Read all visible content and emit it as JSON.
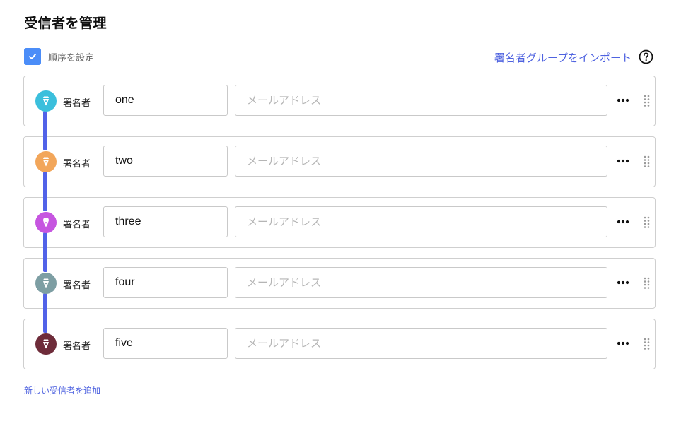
{
  "header": {
    "title": "受信者を管理"
  },
  "order": {
    "label": "順序を設定",
    "checked": true
  },
  "import_link": "署名者グループをインポート",
  "colors": {
    "accent": "#4f63e0",
    "connector": "#5162e8",
    "checkbox": "#4b8df8"
  },
  "recipients": [
    {
      "role": "署名者",
      "name": "one",
      "email": "",
      "email_placeholder": "メールアドレス",
      "avatar_color": "#3bbfdc",
      "icon": "pen-nib-icon"
    },
    {
      "role": "署名者",
      "name": "two",
      "email": "",
      "email_placeholder": "メールアドレス",
      "avatar_color": "#f2a65a",
      "icon": "pen-nib-icon"
    },
    {
      "role": "署名者",
      "name": "three",
      "email": "",
      "email_placeholder": "メールアドレス",
      "avatar_color": "#c655e0",
      "icon": "pen-nib-icon"
    },
    {
      "role": "署名者",
      "name": "four",
      "email": "",
      "email_placeholder": "メールアドレス",
      "avatar_color": "#7d9ea3",
      "icon": "pen-nib-icon"
    },
    {
      "role": "署名者",
      "name": "five",
      "email": "",
      "email_placeholder": "メールアドレス",
      "avatar_color": "#6e2c3a",
      "icon": "pen-nib-icon"
    }
  ],
  "add_link": "新しい受信者を追加"
}
